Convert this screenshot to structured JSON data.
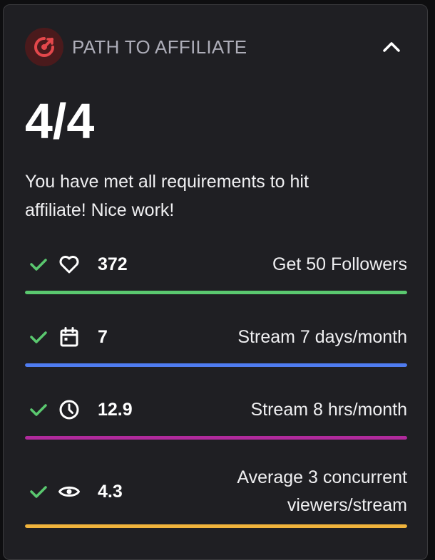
{
  "header": {
    "title": "PATH TO AFFILIATE",
    "badge_icon": "affiliate-target-icon",
    "collapse_icon": "chevron-up-icon"
  },
  "progress": {
    "score": "4/4",
    "message": "You have met all requirements to hit affiliate! Nice work!"
  },
  "requirements": [
    {
      "icon": "heart-icon",
      "value": "372",
      "goal": "Get 50 Followers",
      "completed": true,
      "progress": 1.0,
      "color": "#5ac86f"
    },
    {
      "icon": "calendar-icon",
      "value": "7",
      "goal": "Stream 7 days/month",
      "completed": true,
      "progress": 1.0,
      "color": "#4f7cf0"
    },
    {
      "icon": "clock-icon",
      "value": "12.9",
      "goal": "Stream 8 hrs/month",
      "completed": true,
      "progress": 1.0,
      "color": "#b02a9c"
    },
    {
      "icon": "eye-icon",
      "value": "4.3",
      "goal": "Average 3 concurrent viewers/stream",
      "completed": true,
      "progress": 1.0,
      "color": "#f0b33c"
    }
  ],
  "colors": {
    "check": "#5ac86f",
    "badge_bg": "#4a1a1c",
    "badge_icon": "#e4474b"
  }
}
